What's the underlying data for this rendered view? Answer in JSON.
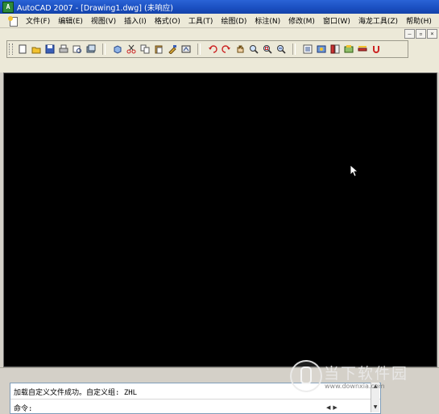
{
  "window": {
    "title": "AutoCAD 2007 - [Drawing1.dwg] (未响应)",
    "app_icon_letter": "A"
  },
  "menu": {
    "items": [
      {
        "label": "文件(F)",
        "name": "menu-file"
      },
      {
        "label": "编辑(E)",
        "name": "menu-edit"
      },
      {
        "label": "视图(V)",
        "name": "menu-view"
      },
      {
        "label": "插入(I)",
        "name": "menu-insert"
      },
      {
        "label": "格式(O)",
        "name": "menu-format"
      },
      {
        "label": "工具(T)",
        "name": "menu-tools"
      },
      {
        "label": "绘图(D)",
        "name": "menu-draw"
      },
      {
        "label": "标注(N)",
        "name": "menu-dimension"
      },
      {
        "label": "修改(M)",
        "name": "menu-modify"
      },
      {
        "label": "窗口(W)",
        "name": "menu-window"
      },
      {
        "label": "海龙工具(Z)",
        "name": "menu-hailong-tools"
      },
      {
        "label": "帮助(H)",
        "name": "menu-help"
      }
    ]
  },
  "mdi": {
    "minimize": "–",
    "restore": "▫",
    "close": "×"
  },
  "toolbar": {
    "icons": [
      "new-icon",
      "open-icon",
      "save-icon",
      "print-icon",
      "plot-preview-icon",
      "publish-icon",
      "3d-dwf-icon",
      "cut-icon",
      "copy-icon",
      "paste-icon",
      "match-properties-icon",
      "block-editor-icon",
      "undo-icon",
      "redo-icon",
      "pan-icon",
      "zoom-realtime-icon",
      "zoom-window-icon",
      "zoom-previous-icon",
      "properties-icon",
      "designcenter-icon",
      "tool-palettes-icon",
      "sheet-set-icon",
      "markup-icon",
      "calculator-icon"
    ]
  },
  "command": {
    "line1": "加载自定义文件成功。自定义组: ZHL",
    "line2": "命令:"
  },
  "watermark": {
    "text": "当下软件园",
    "url": "www.downxia.com"
  },
  "colors": {
    "titlebar": "#1a4fc0",
    "canvas": "#000000",
    "chrome": "#ece9d8"
  }
}
